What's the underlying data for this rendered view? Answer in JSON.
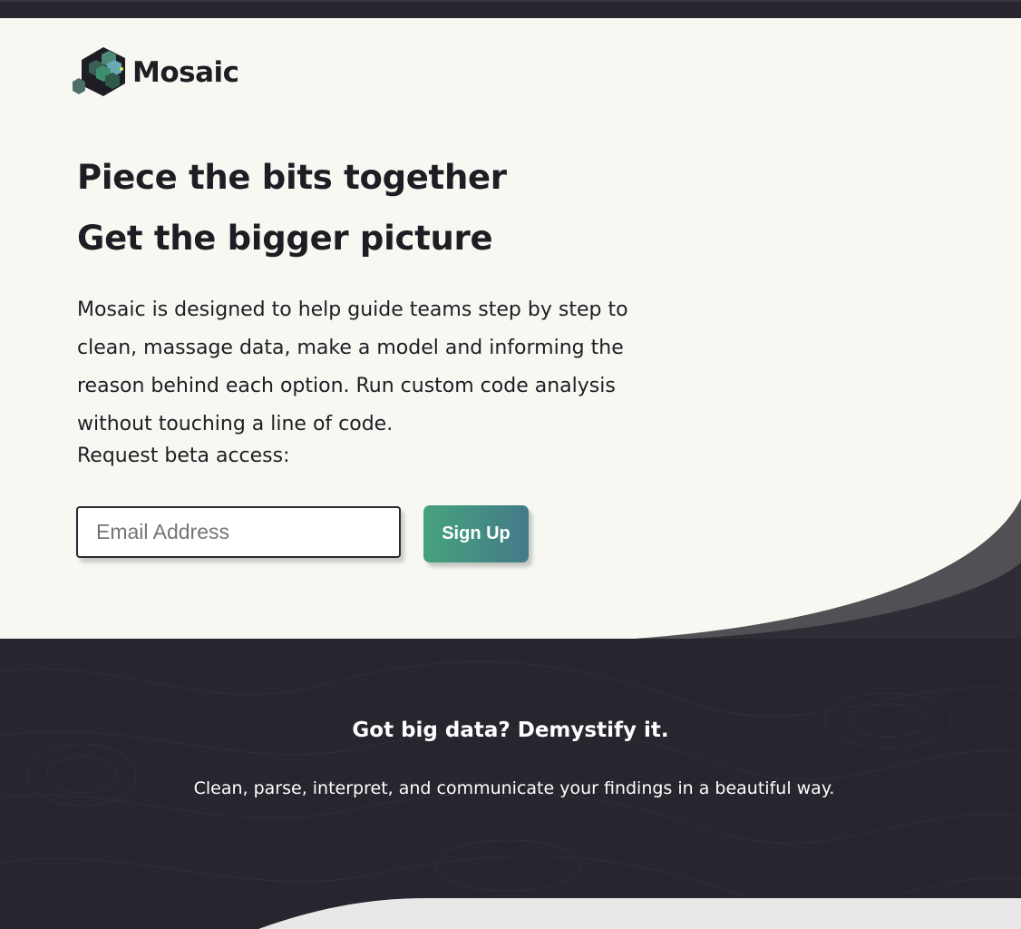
{
  "brand": {
    "name": "Mosaic",
    "logo_icon": "hexagon-cubes-logo"
  },
  "hero": {
    "headline_1": "Piece the bits together",
    "headline_2": "Get the bigger picture",
    "description": "Mosaic is designed to help guide teams step by step to clean, massage data, make a model and informing the reason behind each option. Run custom code analysis without touching a line of code.",
    "request_label": "Request beta access:",
    "email_placeholder": "Email Address",
    "email_value": "",
    "signup_label": "Sign Up"
  },
  "features": {
    "tagline": "Got big data? Demystify it.",
    "subline": "Clean, parse, interpret, and communicate your findings in a beautiful way."
  },
  "colors": {
    "hero_background": "#f8f8f2",
    "dark_background": "#27252d",
    "text_dark": "#1f1d24",
    "button_gradient_start": "#46a37c",
    "button_gradient_end": "#437a8a",
    "wave_grey": "#505055",
    "bottom_section": "#e8e8e8"
  }
}
